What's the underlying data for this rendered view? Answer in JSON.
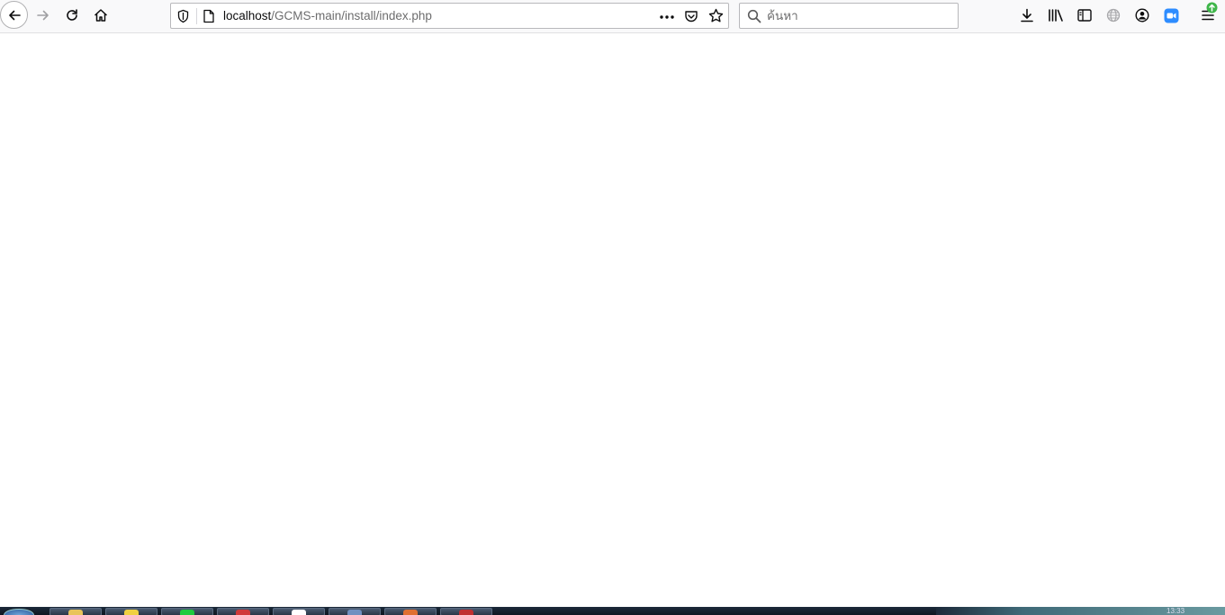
{
  "browser": {
    "url": {
      "host": "localhost",
      "path": "/GCMS-main/install/index.php"
    },
    "search": {
      "placeholder": "ค้นหา"
    },
    "icons": [
      "back-icon",
      "forward-icon",
      "reload-icon",
      "home-icon",
      "shield-icon",
      "page-icon",
      "more-icon",
      "pocket-icon",
      "star-icon",
      "search-icon",
      "download-icon",
      "library-icon",
      "sidebar-icon",
      "globe-icon",
      "account-icon",
      "zoom-extension-icon",
      "menu-icon",
      "update-badge-icon"
    ]
  },
  "taskbar": {
    "clock": "13:33"
  },
  "colors": {
    "toolbar": "#f9f9fa",
    "accent": "#2d8cff",
    "update_badge": "#3fb64a"
  }
}
